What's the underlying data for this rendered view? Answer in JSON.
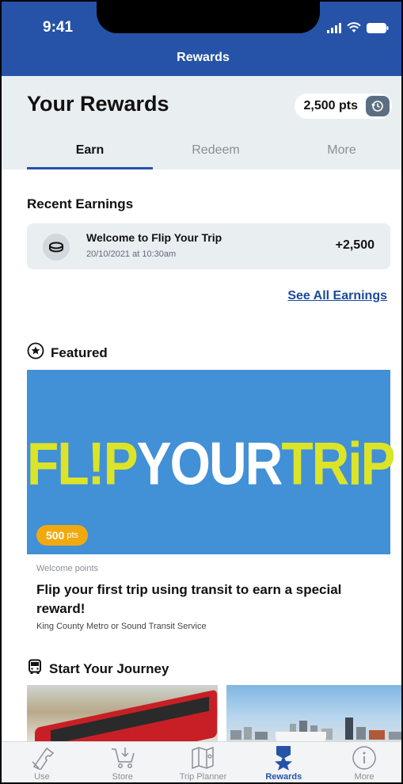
{
  "status_bar": {
    "time": "9:41"
  },
  "nav": {
    "title": "Rewards"
  },
  "header": {
    "title": "Your Rewards",
    "points_balance": "2,500 pts",
    "history_icon": "history-icon"
  },
  "tabs": [
    {
      "label": "Earn",
      "active": true
    },
    {
      "label": "Redeem",
      "active": false
    },
    {
      "label": "More",
      "active": false
    }
  ],
  "recent_earnings": {
    "title": "Recent Earnings",
    "items": [
      {
        "icon": "coin-icon",
        "title": "Welcome to Flip Your Trip",
        "date": "20/10/2021 at 10:30am",
        "amount": "+2,500"
      }
    ],
    "see_all_label": "See All Earnings"
  },
  "featured": {
    "title": "Featured",
    "icon": "star-circle-icon",
    "banner": {
      "logo_parts": [
        "FL!P",
        "YOUR",
        "TRiP"
      ],
      "badge_value": "500",
      "badge_unit": "pts",
      "bg_color": "#4290d6",
      "logo_yellow": "#dbe429"
    },
    "kicker": "Welcome points",
    "headline": "Flip your first trip using transit to earn a special reward!",
    "subtitle": "King County Metro or Sound Transit Service"
  },
  "journey": {
    "title": "Start Your Journey",
    "icon": "bus-icon"
  },
  "bottom_nav": [
    {
      "label": "Use",
      "icon": "ticket-icon",
      "active": false
    },
    {
      "label": "Store",
      "icon": "cart-icon",
      "active": false
    },
    {
      "label": "Trip Planner",
      "icon": "map-icon",
      "active": false
    },
    {
      "label": "Rewards",
      "icon": "rewards-icon",
      "active": true
    },
    {
      "label": "More",
      "icon": "info-icon",
      "active": false
    }
  ],
  "colors": {
    "brand_blue": "#2653a8",
    "header_grey": "#e9eef1",
    "badge_orange": "#f1a90f",
    "link_blue": "#1a4a9a"
  }
}
